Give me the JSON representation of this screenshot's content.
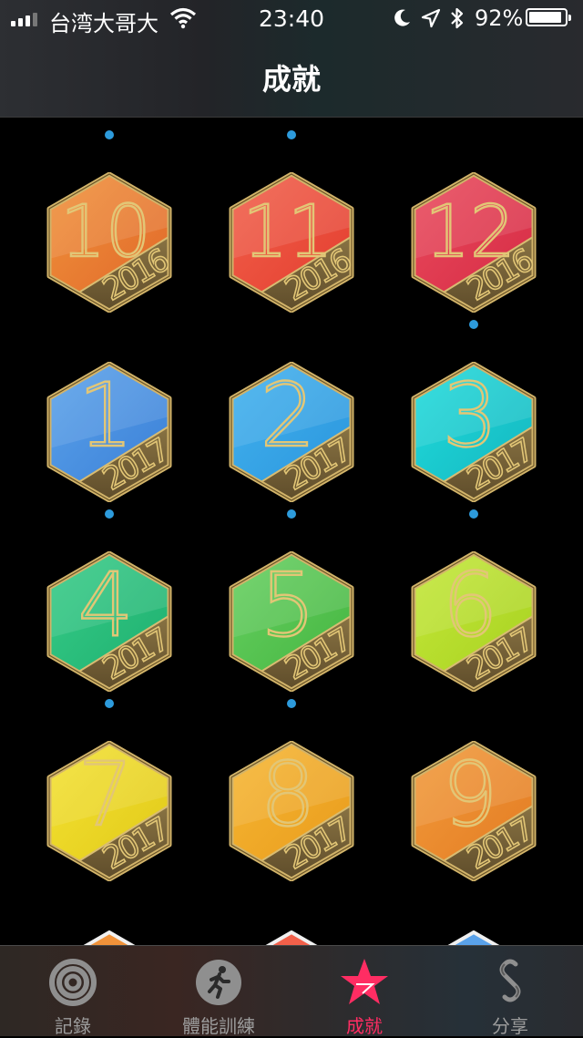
{
  "status_bar": {
    "carrier": "台湾大哥大",
    "time": "23:40",
    "battery_percent": "92%",
    "battery_level": 0.92,
    "signal_bars": 3,
    "icons": [
      "signal-icon",
      "wifi-icon",
      "moon-icon",
      "location-arrow-icon",
      "bluetooth-icon",
      "battery-icon"
    ]
  },
  "header": {
    "title": "成就"
  },
  "badges": [
    {
      "number": "10",
      "year": "2016",
      "top": "#f0923a",
      "bottom_tint": "#e0662a",
      "dot": false
    },
    {
      "number": "11",
      "year": "2016",
      "top": "#f2604a",
      "bottom_tint": "#e23c2e",
      "dot": false
    },
    {
      "number": "12",
      "year": "2016",
      "top": "#ea4a5c",
      "bottom_tint": "#d42a44",
      "dot": true
    },
    {
      "number": "1",
      "year": "2017",
      "top": "#5aa2ea",
      "bottom_tint": "#3a7ed6",
      "dot": true
    },
    {
      "number": "2",
      "year": "2017",
      "top": "#42b2ee",
      "bottom_tint": "#2a94dc",
      "dot": true
    },
    {
      "number": "3",
      "year": "2017",
      "top": "#20dcdc",
      "bottom_tint": "#14b4be",
      "dot": true
    },
    {
      "number": "4",
      "year": "2017",
      "top": "#36cc88",
      "bottom_tint": "#1eae6e",
      "dot": true
    },
    {
      "number": "5",
      "year": "2017",
      "top": "#66d060",
      "bottom_tint": "#44b440",
      "dot": true
    },
    {
      "number": "6",
      "year": "2017",
      "top": "#c4e838",
      "bottom_tint": "#a6d020",
      "dot": false
    },
    {
      "number": "7",
      "year": "2017",
      "top": "#f4e232",
      "bottom_tint": "#e0c818",
      "dot": false
    },
    {
      "number": "8",
      "year": "2017",
      "top": "#f6b632",
      "bottom_tint": "#e89a1c",
      "dot": false
    },
    {
      "number": "9",
      "year": "2017",
      "top": "#f29a3a",
      "bottom_tint": "#e27a22",
      "dot": false
    }
  ],
  "peek_badges_top": [
    {
      "color": "#888888",
      "dot": true
    },
    {
      "color": "#888888",
      "dot": true
    },
    {
      "color": "#b99a55",
      "dot": false
    }
  ],
  "peek_badges_bottom": [
    {
      "color": "#f0923a"
    },
    {
      "color": "#f2604a"
    },
    {
      "color": "#5aa2ea"
    }
  ],
  "colors": {
    "accent_dot": "#2d9bdc",
    "active_tab": "#ff2d63",
    "inactive_tab": "#9c9c9c",
    "gold": "#c9a860"
  },
  "tabs": [
    {
      "label": "記錄",
      "icon": "activity-rings-icon",
      "active": false
    },
    {
      "label": "體能訓練",
      "icon": "running-figure-icon",
      "active": false
    },
    {
      "label": "成就",
      "icon": "star-achievement-icon",
      "active": true
    },
    {
      "label": "分享",
      "icon": "sharing-icon",
      "active": false
    }
  ]
}
